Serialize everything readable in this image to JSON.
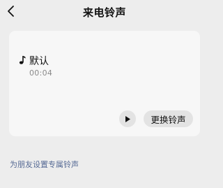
{
  "header": {
    "title": "来电铃声",
    "back_icon": "chevron-left-icon"
  },
  "ringtone": {
    "icon": "music-note-icon",
    "name": "默认",
    "duration": "00:04",
    "play_icon": "play-icon",
    "change_label": "更换铃声"
  },
  "footer": {
    "friend_ringtone_link": "为朋友设置专属铃声"
  },
  "colors": {
    "background": "#ededed",
    "card": "#f7f7f7",
    "button_bg": "#e3e3e3",
    "link": "#576b95",
    "secondary_text": "#8a8a8a"
  }
}
